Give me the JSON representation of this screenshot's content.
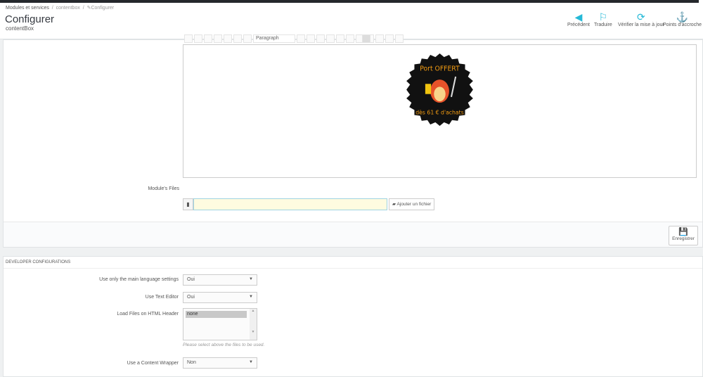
{
  "breadcrumb": {
    "items": [
      "Modules et services",
      "contentbox",
      "Configurer"
    ]
  },
  "header": {
    "title": "Configurer",
    "subtitle": "contentBox"
  },
  "toolbar": {
    "items": [
      {
        "label": "Précédent",
        "icon": "arrow-circle-left-icon"
      },
      {
        "label": "Traduire",
        "icon": "flag-icon"
      },
      {
        "label": "Vérifier la mise à jour",
        "icon": "refresh-icon"
      },
      {
        "label": "Points d'accroche",
        "icon": "anchor-icon"
      }
    ]
  },
  "editor": {
    "format_select": "Paragraph",
    "image_text": {
      "top": "Port OFFERT",
      "bottom": "dès 61 € d'achats"
    }
  },
  "files": {
    "label": "Module's Files",
    "input_value": "",
    "add_button": "Ajouter un fichier"
  },
  "save_button": "Enregistrer",
  "dev": {
    "heading": "DEVELOPER CONFIGURATIONS",
    "main_lang": {
      "label": "Use only the main language settings",
      "value": "Oui"
    },
    "text_editor": {
      "label": "Use Text Editor",
      "value": "Oui"
    },
    "load_files": {
      "label": "Load Files on HTML Header",
      "option": "none",
      "help": "Please select above the files to be used."
    },
    "wrapper": {
      "label": "Use a Content Wrapper",
      "value": "Non"
    }
  },
  "colors": {
    "accent": "#25b9d7",
    "input_highlight": "#fefbe0"
  }
}
